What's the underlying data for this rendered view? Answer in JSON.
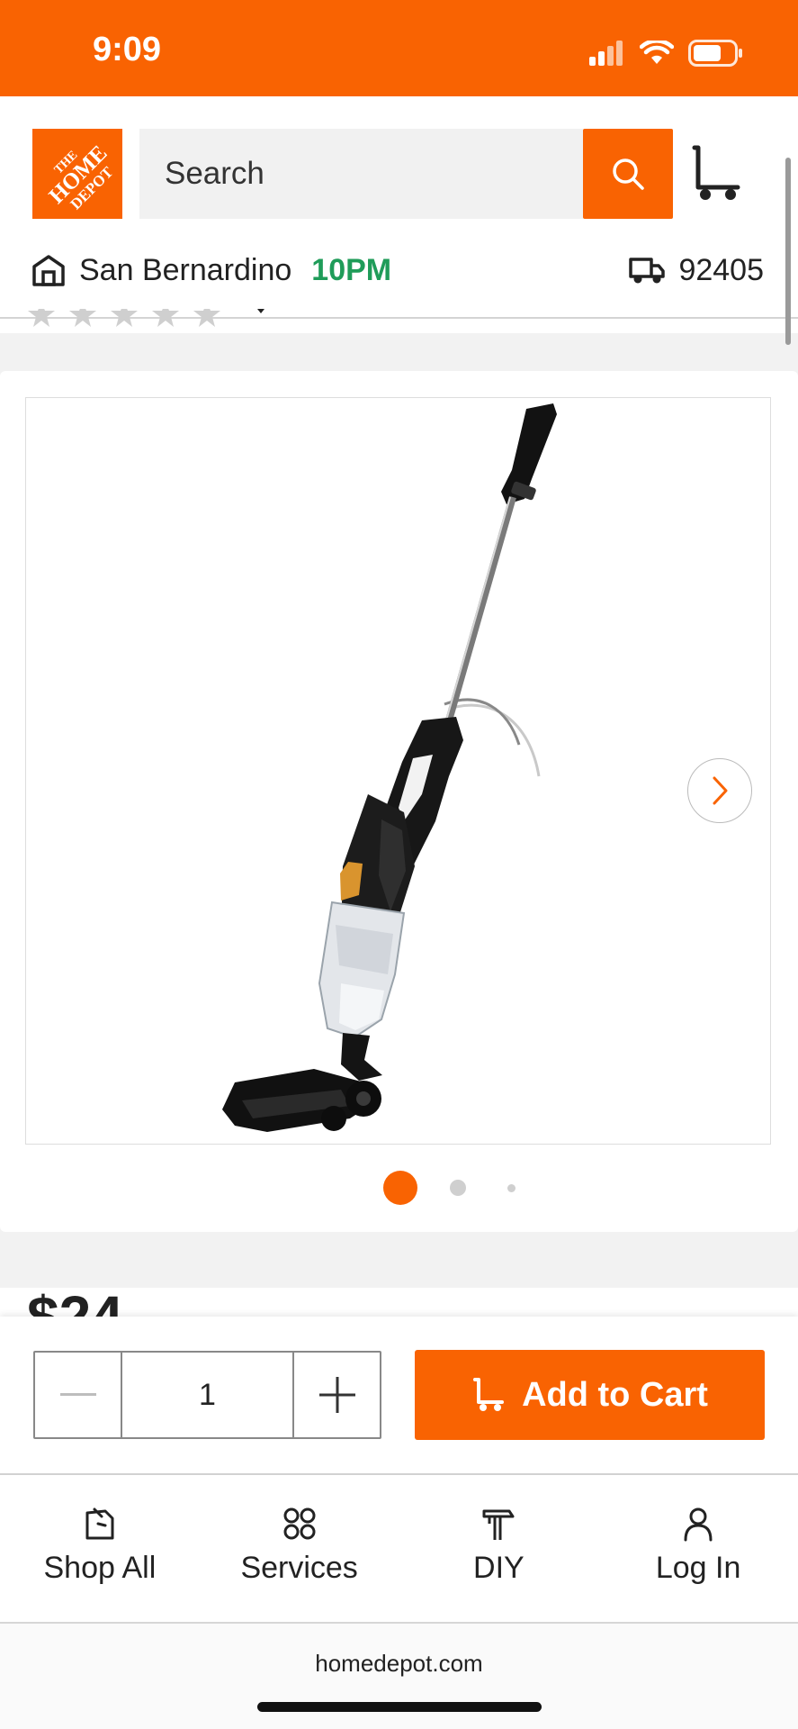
{
  "status_bar": {
    "time": "9:09",
    "battery_level": 0.7
  },
  "header": {
    "logo_text": "THE HOME DEPOT",
    "search": {
      "placeholder": "Search",
      "value": ""
    },
    "store": {
      "name": "San Bernardino",
      "hours": "10PM"
    },
    "delivery_zip": "92405"
  },
  "product": {
    "image_alt": "Handheld stick vacuum",
    "gallery": {
      "total_images": 3,
      "current_index": 1
    },
    "price_partial": "$24"
  },
  "purchase_bar": {
    "quantity": "1",
    "add_to_cart_label": "Add to Cart"
  },
  "tabbar": {
    "items": [
      {
        "label": "Shop All",
        "icon": "shop-all-icon"
      },
      {
        "label": "Services",
        "icon": "services-icon"
      },
      {
        "label": "DIY",
        "icon": "diy-icon"
      },
      {
        "label": "Log In",
        "icon": "user-icon"
      }
    ]
  },
  "browser": {
    "url": "homedepot.com"
  },
  "colors": {
    "brand": "#f96302",
    "store_hours": "#1f9c59"
  }
}
